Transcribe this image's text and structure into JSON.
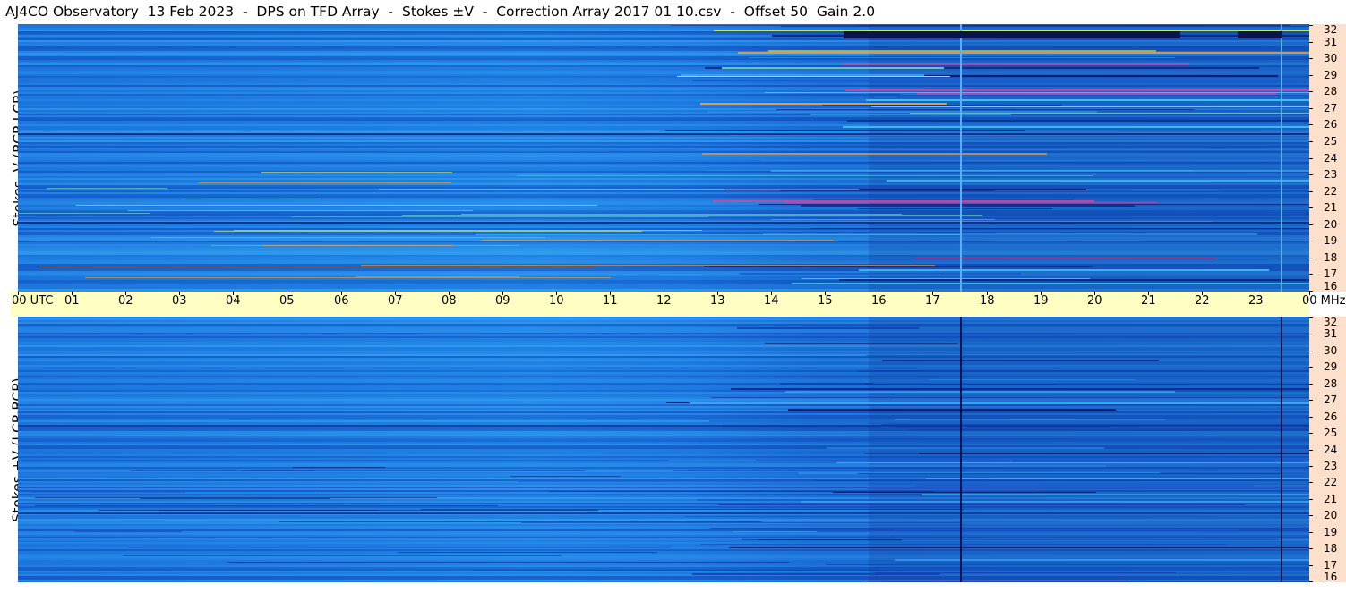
{
  "title": "AJ4CO Observatory  13 Feb 2023  -  DPS on TFD Array  -  Stokes ±V  -  Correction Array 2017 01 10.csv  -  Offset 50  Gain 2.0",
  "time_axis": {
    "labels": [
      "00  UTC",
      "01",
      "02",
      "03",
      "04",
      "05",
      "06",
      "07",
      "08",
      "09",
      "10",
      "11",
      "12",
      "13",
      "14",
      "15",
      "16",
      "17",
      "18",
      "19",
      "20",
      "21",
      "22",
      "23",
      "00 MHz"
    ]
  },
  "chart_data": [
    {
      "type": "heatmap",
      "title": "AJ4CO Observatory  13 Feb 2023  -  DPS on TFD Array  -  Stokes ±V  -  Correction Array 2017 01 10.csv  -  Offset 50  Gain 2.0",
      "ylabel": "Stokes -V (RCP-LCP)",
      "xlabel": "UTC",
      "x_range": [
        "00",
        "00"
      ],
      "ylim": [
        16,
        32
      ],
      "y_ticks": [
        "16",
        "17",
        "18",
        "19",
        "20",
        "21",
        "22",
        "23",
        "24",
        "25",
        "26",
        "27",
        "28",
        "29",
        "30",
        "31",
        "32"
      ],
      "y_unit": "MHz"
    },
    {
      "type": "heatmap",
      "ylabel": "Stokes +V (LCP-RCP)",
      "xlabel": "UTC",
      "x_range": [
        "00",
        "00"
      ],
      "ylim": [
        16,
        32
      ],
      "y_ticks": [
        "16",
        "17",
        "18",
        "19",
        "20",
        "21",
        "22",
        "23",
        "24",
        "25",
        "26",
        "27",
        "28",
        "29",
        "30",
        "31",
        "32"
      ],
      "y_unit": "MHz"
    }
  ],
  "colors": {
    "background": "#ffffff",
    "time_axis_bg": "#ffffc4",
    "freq_axis_bg": "#fde0cc",
    "low": "#0a1a6a",
    "mid": "#1e78e0",
    "high": "#f0f060"
  }
}
